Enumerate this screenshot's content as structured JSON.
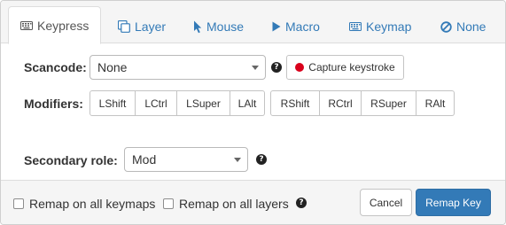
{
  "tabs": [
    {
      "label": "Keypress",
      "icon": "keyboard-icon",
      "active": true
    },
    {
      "label": "Layer",
      "icon": "layer-icon",
      "active": false
    },
    {
      "label": "Mouse",
      "icon": "mouse-pointer-icon",
      "active": false
    },
    {
      "label": "Macro",
      "icon": "play-icon",
      "active": false
    },
    {
      "label": "Keymap",
      "icon": "keyboard-icon",
      "active": false
    },
    {
      "label": "None",
      "icon": "ban-icon",
      "active": false
    }
  ],
  "scancode": {
    "label": "Scancode:",
    "value": "None",
    "help": "?",
    "capture_label": "Capture keystroke"
  },
  "modifiers": {
    "label": "Modifiers:",
    "left": [
      "LShift",
      "LCtrl",
      "LSuper",
      "LAlt"
    ],
    "right": [
      "RShift",
      "RCtrl",
      "RSuper",
      "RAlt"
    ]
  },
  "secondary_role": {
    "label": "Secondary role:",
    "value": "Mod",
    "help": "?"
  },
  "footer": {
    "remap_all_keymaps": "Remap on all keymaps",
    "remap_all_layers": "Remap on all layers",
    "help": "?",
    "cancel_label": "Cancel",
    "remap_label": "Remap Key"
  },
  "colors": {
    "link": "#337ab7",
    "primary": "#337ab7",
    "record": "#d9001b"
  }
}
